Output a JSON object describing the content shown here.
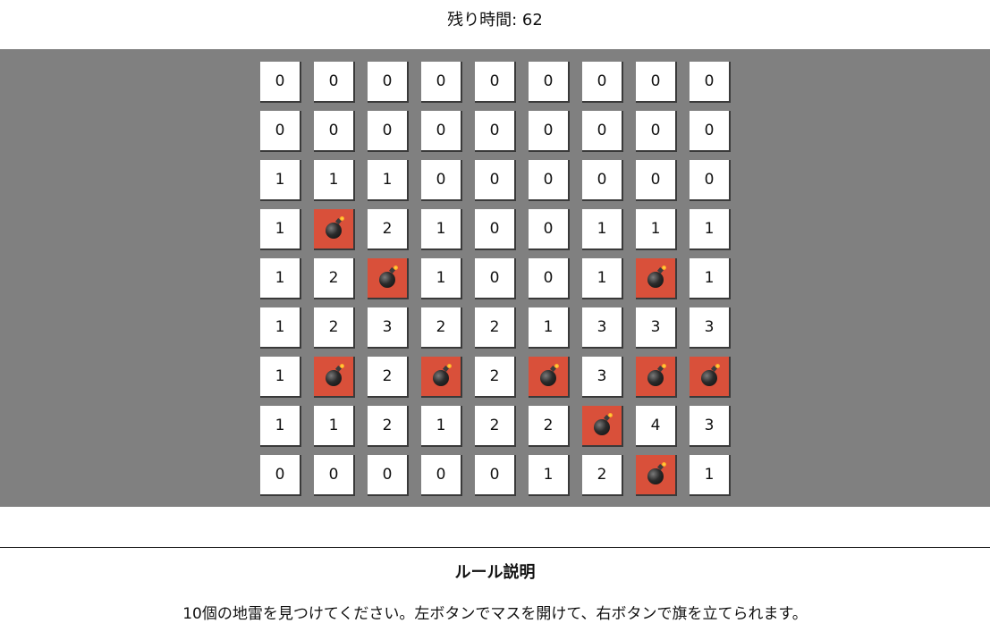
{
  "timer": {
    "label": "残り時間: 62"
  },
  "board": {
    "rows": [
      [
        "0",
        "0",
        "0",
        "0",
        "0",
        "0",
        "0",
        "0",
        "0"
      ],
      [
        "0",
        "0",
        "0",
        "0",
        "0",
        "0",
        "0",
        "0",
        "0"
      ],
      [
        "1",
        "1",
        "1",
        "0",
        "0",
        "0",
        "0",
        "0",
        "0"
      ],
      [
        "1",
        "mine",
        "2",
        "1",
        "0",
        "0",
        "1",
        "1",
        "1"
      ],
      [
        "1",
        "2",
        "mine",
        "1",
        "0",
        "0",
        "1",
        "mine",
        "1"
      ],
      [
        "1",
        "2",
        "3",
        "2",
        "2",
        "1",
        "3",
        "3",
        "3"
      ],
      [
        "1",
        "mine",
        "2",
        "mine",
        "2",
        "mine",
        "3",
        "mine",
        "mine"
      ],
      [
        "1",
        "1",
        "2",
        "1",
        "2",
        "2",
        "mine",
        "4",
        "3"
      ],
      [
        "0",
        "0",
        "0",
        "0",
        "0",
        "1",
        "2",
        "mine",
        "1"
      ]
    ],
    "mine_color": "#d9503a",
    "background_color": "#808080",
    "mine_icon": "bomb-icon"
  },
  "rules": {
    "title": "ルール説明",
    "text": "10個の地雷を見つけてください。左ボタンでマスを開けて、右ボタンで旗を立てられます。"
  }
}
